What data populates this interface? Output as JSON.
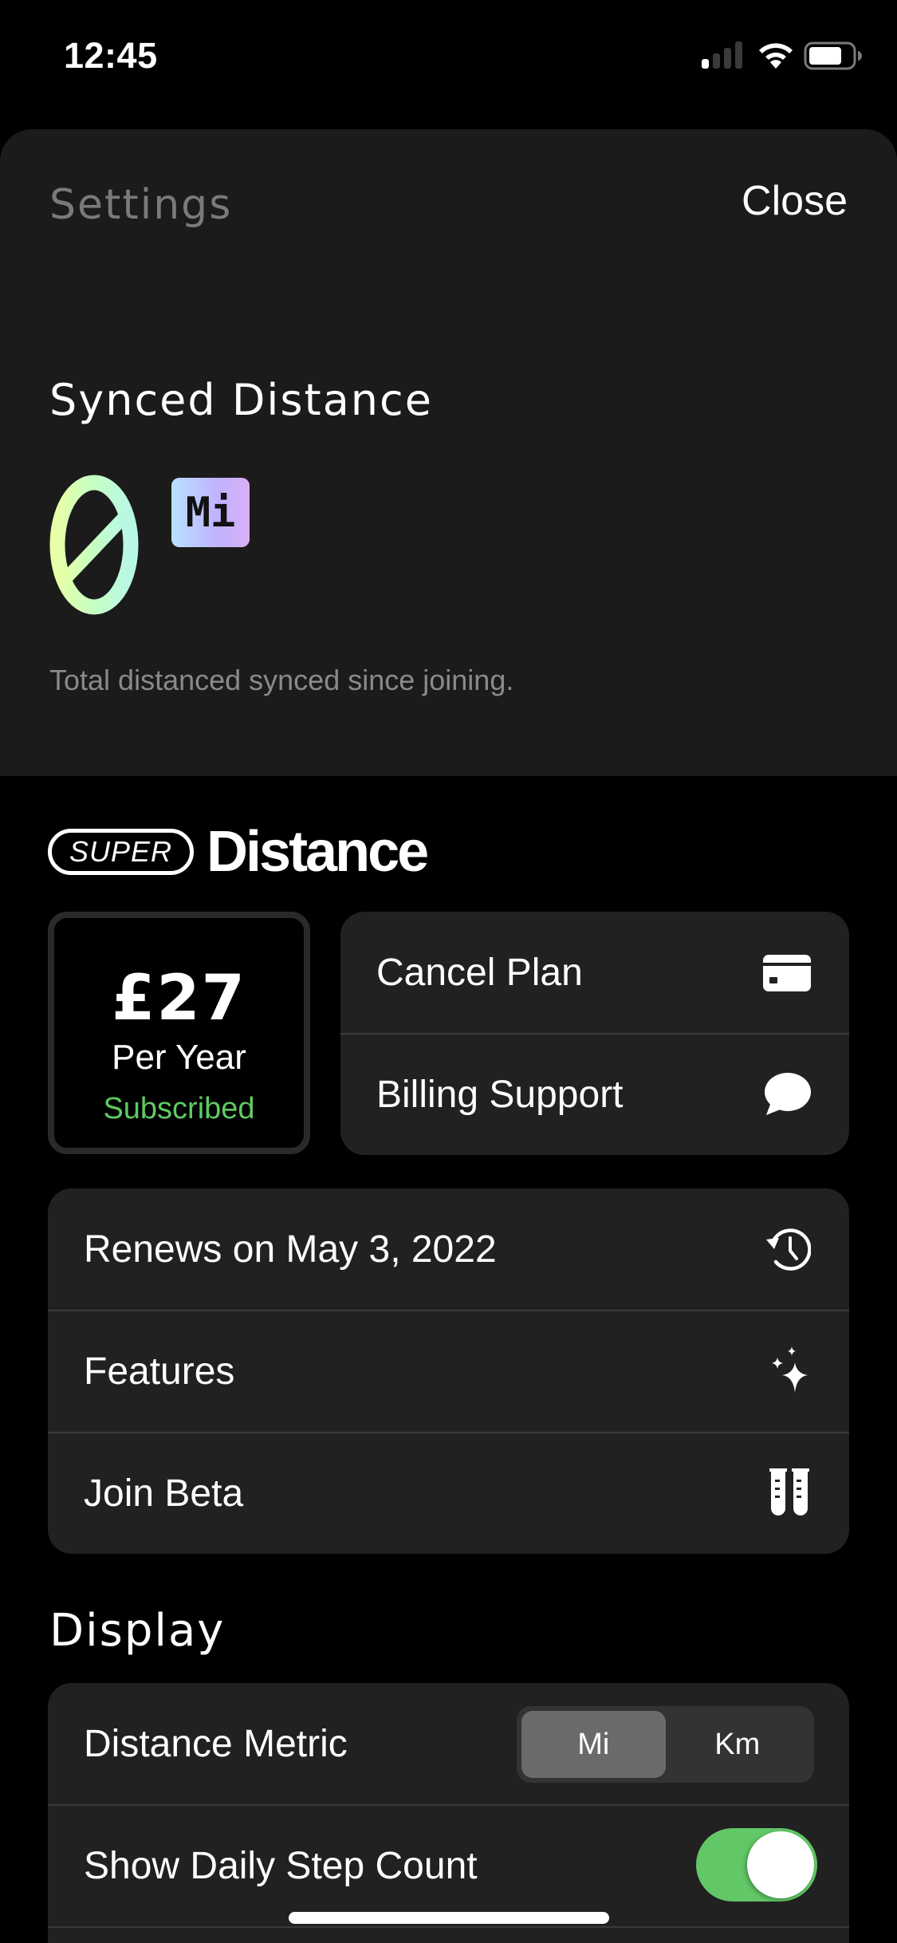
{
  "status_bar": {
    "time": "12:45",
    "signal_bars_active": 1,
    "signal_bars_total": 4,
    "battery_level": 0.8
  },
  "header": {
    "title": "Settings",
    "close_label": "Close"
  },
  "synced": {
    "title": "Synced Distance",
    "value": "0",
    "unit": "Mi",
    "caption": "Total distanced synced since joining."
  },
  "brand": {
    "super_label": "SUPER",
    "name": "Distance"
  },
  "plan": {
    "price": "£27",
    "period": "Per Year",
    "status": "Subscribed",
    "status_color": "#5fcb62"
  },
  "actions": [
    {
      "label": "Cancel Plan",
      "icon": "credit-card-icon"
    },
    {
      "label": "Billing Support",
      "icon": "chat-bubble-icon"
    }
  ],
  "list": [
    {
      "label": "Renews on May 3, 2022",
      "icon": "history-clock-icon"
    },
    {
      "label": "Features",
      "icon": "sparkles-icon"
    },
    {
      "label": "Join Beta",
      "icon": "test-tubes-icon"
    }
  ],
  "display": {
    "title": "Display",
    "metric_label": "Distance Metric",
    "metric_options": [
      "Mi",
      "Km"
    ],
    "metric_selected": "Mi",
    "step_count_label": "Show Daily Step Count",
    "step_count_enabled": true,
    "toggle_color": "#62c766"
  }
}
